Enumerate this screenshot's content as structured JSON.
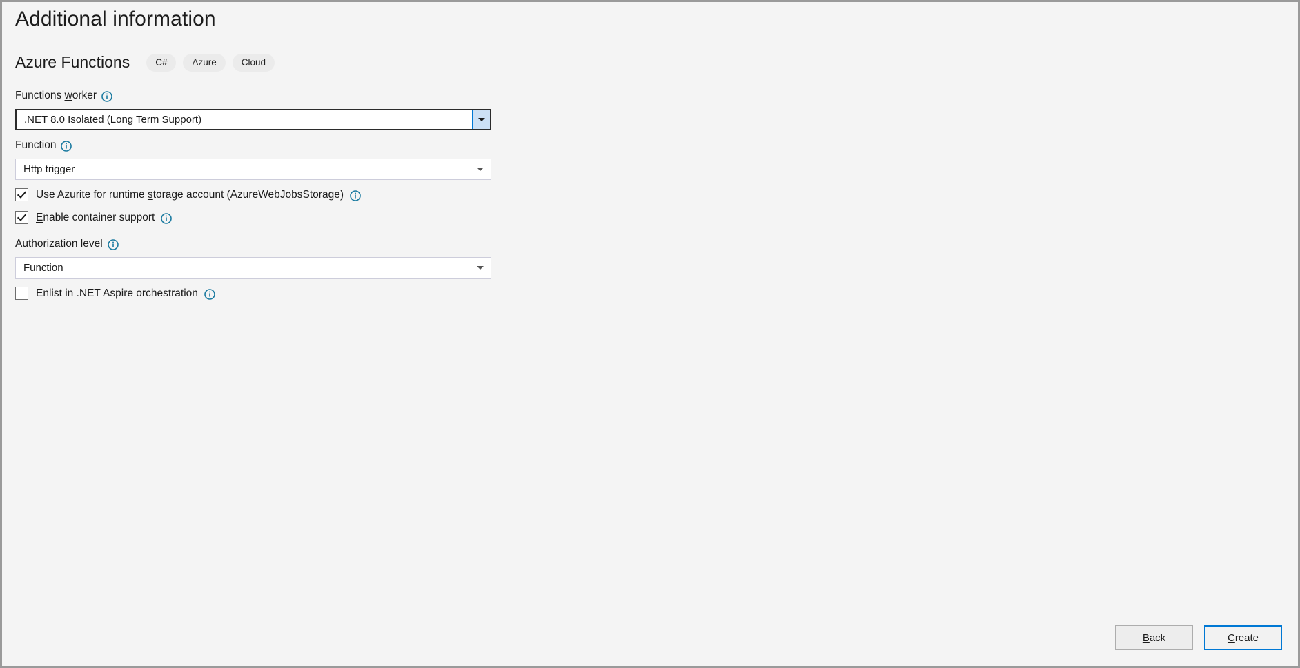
{
  "window": {
    "title": "Additional information",
    "background": "#f4f4f4",
    "border_color": "#9a9a9a"
  },
  "header": {
    "title": "Additional information",
    "project_name": "Azure Functions",
    "tags": [
      "C#",
      "Azure",
      "Cloud"
    ]
  },
  "form": {
    "functions_worker": {
      "label_before": "Functions ",
      "label_accel": "w",
      "label_after": "orker",
      "info_icon": "info-icon",
      "value": ".NET 8.0 Isolated (Long Term Support)",
      "focused": true
    },
    "function": {
      "label_accel": "F",
      "label_after": "unction",
      "info_icon": "info-icon",
      "value": "Http trigger",
      "focused": false
    },
    "use_azurite": {
      "label_before": "Use Azurite for runtime ",
      "label_accel": "s",
      "label_after": "torage account (AzureWebJobsStorage)",
      "checked": true,
      "info_icon": "info-icon"
    },
    "enable_container": {
      "label_accel": "E",
      "label_after": "nable container support",
      "checked": true,
      "info_icon": "info-icon"
    },
    "authorization_level": {
      "label": "Authorization level",
      "info_icon": "info-icon",
      "value": "Function",
      "focused": false
    },
    "enlist_aspire": {
      "label": "Enlist in .NET Aspire orchestration",
      "checked": false,
      "info_icon": "info-icon"
    }
  },
  "footer": {
    "back": {
      "prefix": "",
      "accel": "B",
      "suffix": "ack"
    },
    "create": {
      "prefix": "",
      "accel": "C",
      "suffix": "reate",
      "accent": "#0078d4"
    }
  },
  "colors": {
    "accent_blue": "#0078d4",
    "info_teal": "#1a7aa0",
    "surface": "#f4f4f4",
    "field_bg": "#ffffff",
    "field_border": "#cdcddb",
    "focus_border": "#2b2b2b",
    "tag_bg": "#ebebeb"
  }
}
